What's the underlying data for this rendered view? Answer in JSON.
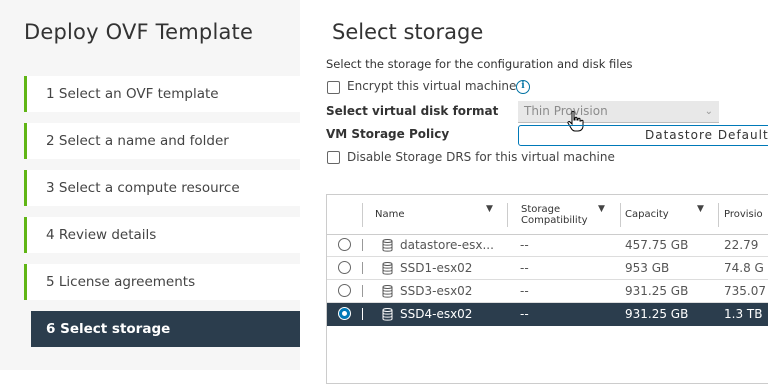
{
  "sidebar": {
    "title": "Deploy OVF Template",
    "steps": [
      {
        "label": "1  Select an OVF template",
        "state": "done"
      },
      {
        "label": "2  Select a name and folder",
        "state": "done"
      },
      {
        "label": "3  Select a compute resource",
        "state": "done"
      },
      {
        "label": "4  Review details",
        "state": "done"
      },
      {
        "label": "5  License agreements",
        "state": "done"
      },
      {
        "label": "6  Select storage",
        "state": "active"
      }
    ]
  },
  "main": {
    "title": "Select storage",
    "subtitle": "Select the storage for the configuration and disk files",
    "encrypt_label": "Encrypt this virtual machine",
    "encrypt_checked": false,
    "disk_format_label": "Select virtual disk format",
    "disk_format_value": "Thin Provision",
    "policy_label": "VM Storage Policy",
    "policy_value": "Datastore Default",
    "drs_label": "Disable Storage DRS for this virtual machine",
    "drs_checked": false
  },
  "table": {
    "columns": [
      "Name",
      "Storage Compatibility",
      "Capacity",
      "Provisio"
    ],
    "rows": [
      {
        "name": "datastore-esx...",
        "compat": "--",
        "capacity": "457.75 GB",
        "provisioned": "22.79",
        "selected": false
      },
      {
        "name": "SSD1-esx02",
        "compat": "--",
        "capacity": "953 GB",
        "provisioned": "74.8 G",
        "selected": false
      },
      {
        "name": "SSD3-esx02",
        "compat": "--",
        "capacity": "931.25 GB",
        "provisioned": "735.07",
        "selected": false
      },
      {
        "name": "SSD4-esx02",
        "compat": "--",
        "capacity": "931.25 GB",
        "provisioned": "1.3 TB",
        "selected": true
      }
    ]
  },
  "colors": {
    "accent_green": "#60b515",
    "active_step_bg": "#2b3d4d",
    "link_blue": "#0079b8",
    "info_blue": "#0072a3"
  }
}
